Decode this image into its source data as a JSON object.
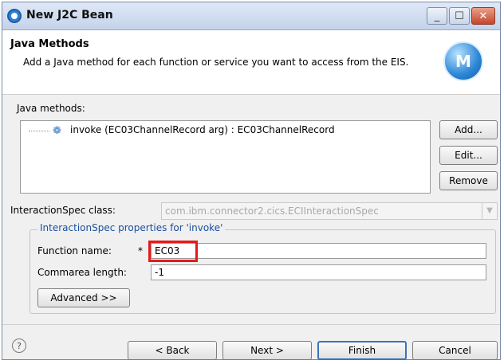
{
  "window": {
    "title": "New J2C Bean",
    "min_symbol": "_",
    "max_symbol": "☐",
    "close_symbol": "✕"
  },
  "header": {
    "title": "Java Methods",
    "description": "Add a Java method for each function or service you want to access from the EIS.",
    "logo_letter": "M"
  },
  "methods": {
    "label": "Java methods:",
    "items": [
      {
        "label": "invoke (EC03ChannelRecord arg) : EC03ChannelRecord"
      }
    ],
    "add_label": "Add...",
    "edit_label": "Edit...",
    "remove_label": "Remove"
  },
  "interaction_spec": {
    "label": "InteractionSpec class:",
    "value": "com.ibm.connector2.cics.ECIInteractionSpec"
  },
  "properties": {
    "group_title": "InteractionSpec properties for 'invoke'",
    "function_name_label": "Function name:",
    "required_marker": "*",
    "function_name_value": "EC03",
    "commarea_label": "Commarea length:",
    "commarea_value": "-1",
    "advanced_label": "Advanced >>"
  },
  "footer": {
    "help_symbol": "?",
    "back_label": "< Back",
    "next_label": "Next >",
    "finish_label": "Finish",
    "cancel_label": "Cancel"
  },
  "colors": {
    "highlight": "#e21b1b",
    "group_title": "#1b4fa0",
    "accent": "#2f7fd0"
  }
}
